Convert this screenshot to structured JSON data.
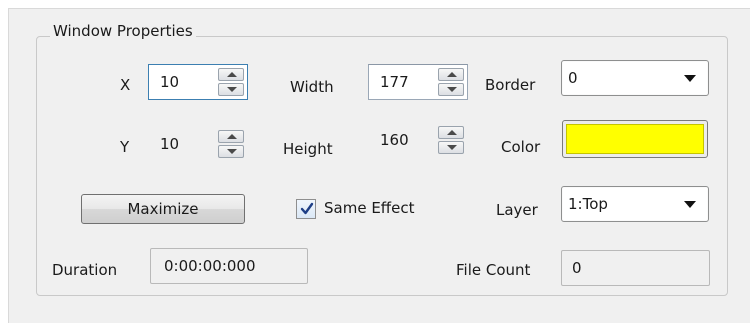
{
  "group": {
    "title": "Window Properties"
  },
  "fields": {
    "x": {
      "label": "X",
      "value": "10"
    },
    "y": {
      "label": "Y",
      "value": "10"
    },
    "width": {
      "label": "Width",
      "value": "177"
    },
    "height": {
      "label": "Height",
      "value": "160"
    },
    "border": {
      "label": "Border",
      "value": "0"
    },
    "color": {
      "label": "Color",
      "value": "#ffff00"
    },
    "layer": {
      "label": "Layer",
      "value": "1:Top"
    },
    "duration": {
      "label": "Duration",
      "value": "0:00:00:000"
    },
    "file_count": {
      "label": "File Count",
      "value": "0"
    }
  },
  "buttons": {
    "maximize": "Maximize"
  },
  "checkbox": {
    "same_effect": {
      "label": "Same Effect",
      "checked": true
    }
  },
  "icons": {
    "spin_up": "spin-up-icon",
    "spin_down": "spin-down-icon",
    "dropdown": "chevron-down-icon",
    "check": "checkmark-icon"
  }
}
